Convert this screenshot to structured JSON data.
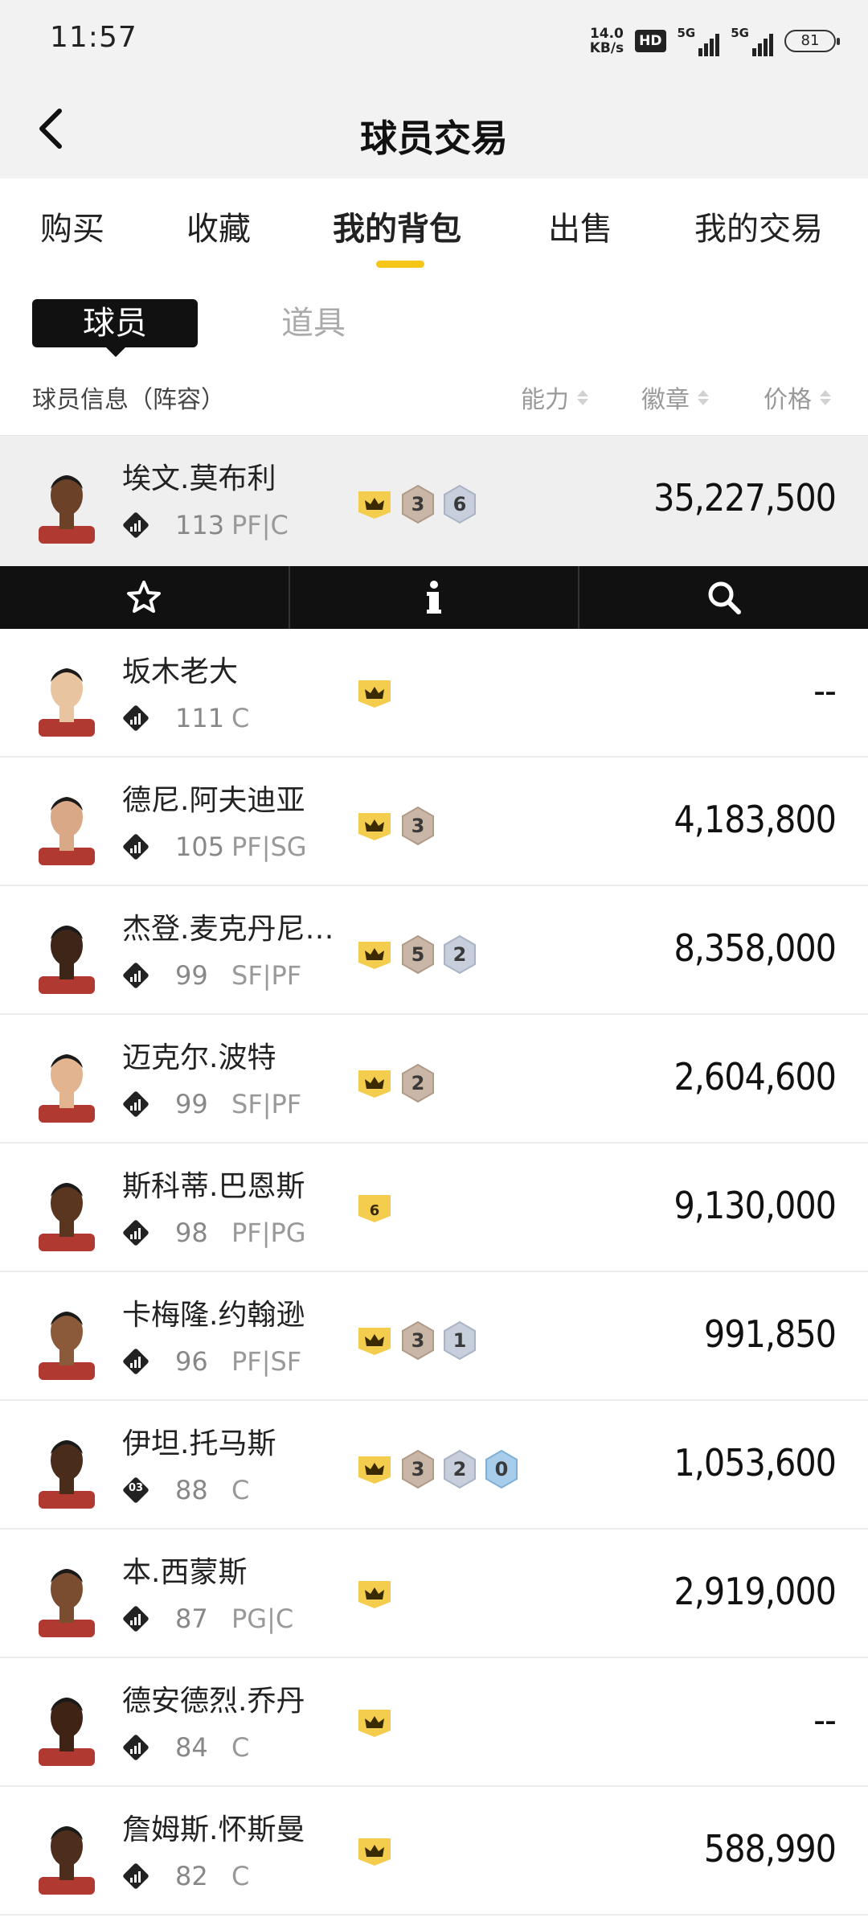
{
  "status_bar": {
    "time": "11:57",
    "net_speed_value": "14.0",
    "net_speed_unit": "KB/s",
    "hd_label": "HD",
    "signal1_label": "5G",
    "signal2_label": "5G",
    "battery": "81"
  },
  "header": {
    "title": "球员交易",
    "back_icon": "chevron-left-icon"
  },
  "tabs": [
    {
      "label": "购买",
      "active": false
    },
    {
      "label": "收藏",
      "active": false
    },
    {
      "label": "我的背包",
      "active": true
    },
    {
      "label": "出售",
      "active": false
    },
    {
      "label": "我的交易",
      "active": false
    }
  ],
  "subtabs": {
    "active": "球员",
    "inactive": "道具"
  },
  "columns": {
    "info": "球员信息（阵容）",
    "ability": "能力",
    "badges": "徽章",
    "price": "价格"
  },
  "action_bar": {
    "icons": [
      "star-icon",
      "info-icon",
      "search-icon"
    ]
  },
  "players": [
    {
      "name": "埃文.莫布利",
      "rating": "113",
      "position": "PF|C",
      "tier_text": "",
      "badges": [
        "crown",
        "3",
        "6"
      ],
      "price": "35,227,500",
      "selected": true,
      "skin": "#6b4128"
    },
    {
      "name": "坂木老大",
      "rating": "111",
      "position": "C",
      "tier_text": "",
      "badges": [
        "crown"
      ],
      "price": "--",
      "selected": false,
      "skin": "#e8c4a0"
    },
    {
      "name": "德尼.阿夫迪亚",
      "rating": "105",
      "position": "PF|SG",
      "tier_text": "",
      "badges": [
        "crown",
        "3"
      ],
      "price": "4,183,800",
      "selected": false,
      "skin": "#d9a987"
    },
    {
      "name": "杰登.麦克丹尼尔斯",
      "rating": "99",
      "position": "SF|PF",
      "tier_text": "",
      "badges": [
        "crown",
        "5",
        "2"
      ],
      "price": "8,358,000",
      "selected": false,
      "skin": "#3d2517"
    },
    {
      "name": "迈克尔.波特",
      "rating": "99",
      "position": "SF|PF",
      "tier_text": "",
      "badges": [
        "crown",
        "2"
      ],
      "price": "2,604,600",
      "selected": false,
      "skin": "#e2b48f"
    },
    {
      "name": "斯科蒂.巴恩斯",
      "rating": "98",
      "position": "PF|PG",
      "tier_text": "",
      "badges": [
        "crown6"
      ],
      "price": "9,130,000",
      "selected": false,
      "skin": "#5a3520"
    },
    {
      "name": "卡梅隆.约翰逊",
      "rating": "96",
      "position": "PF|SF",
      "tier_text": "",
      "badges": [
        "crown",
        "3",
        "1"
      ],
      "price": "991,850",
      "selected": false,
      "skin": "#8a5a3a"
    },
    {
      "name": "伊坦.托马斯",
      "rating": "88",
      "position": "C",
      "tier_text": "03",
      "badges": [
        "crown",
        "3",
        "2",
        "0"
      ],
      "price": "1,053,600",
      "selected": false,
      "skin": "#4a2c1b"
    },
    {
      "name": "本.西蒙斯",
      "rating": "87",
      "position": "PG|C",
      "tier_text": "",
      "badges": [
        "crown"
      ],
      "price": "2,919,000",
      "selected": false,
      "skin": "#7a4d30"
    },
    {
      "name": "德安德烈.乔丹",
      "rating": "84",
      "position": "C",
      "tier_text": "",
      "badges": [
        "crown"
      ],
      "price": "--",
      "selected": false,
      "skin": "#3f2416"
    },
    {
      "name": "詹姆斯.怀斯曼",
      "rating": "82",
      "position": "C",
      "tier_text": "",
      "badges": [
        "crown"
      ],
      "price": "588,990",
      "selected": false,
      "skin": "#4d2e1c"
    }
  ]
}
